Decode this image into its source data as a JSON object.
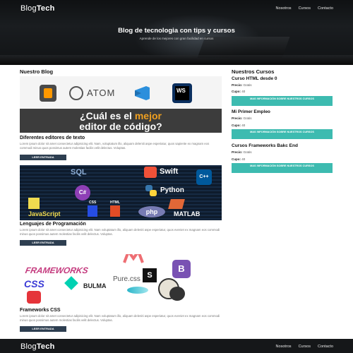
{
  "brand": {
    "name_light": "Blog",
    "name_bold": "Tech"
  },
  "nav": {
    "items": [
      "Nosotros",
      "Cursos",
      "Contacto"
    ]
  },
  "hero": {
    "title": "Blog de tecnologia con tips y cursos",
    "subtitle": "Aprende de los mejores con gran facilidad en cursos"
  },
  "blog": {
    "heading": "Nuestro Blog",
    "posts": [
      {
        "title": "Diferentes editores de texto",
        "excerpt": "Lorem ipsum dolor sit amet consectetur adipisicing elit. Nam, voluptatum illo, aliquam deleniti aspe esperiatur, quos sapiente ex magnam eos commodi minus quos possimus autem molestias facilis velit delectus. Voluptas.",
        "button": "LEER ENTRADA",
        "image_text": {
          "q1": "¿Cuál es el ",
          "hl": "mejor",
          "q2": "editor de código?",
          "atom": "ATOM",
          "ws": "WS"
        }
      },
      {
        "title": "Lenguajes de Programación",
        "excerpt": "Lorem ipsum dolor sit amet consectetur adipisicing elit. Nam voluptatum illo, aliquam deleniti aspe esperiatur, quos eveniet ex magnam eos commodi minus quos possimus autem molestias facilis velit delectus. Voluptas.",
        "button": "LEER ENTRADA",
        "image_text": {
          "sql": "SQL",
          "swift": "Swift",
          "python": "Python",
          "js": "JavaScript",
          "css": "CSS",
          "html": "HTML",
          "php": "php",
          "matlab": "MATLAB",
          "cs": "C#",
          "cpp": "C++"
        }
      },
      {
        "title": "Frameworks CSS",
        "excerpt": "Lorem ipsum dolor sit amet consectetur adipisicing elit. Nam voluptatum illo, aliquam deleniti aspe esperiatur, quos eveniet ex magnam eos commodi minus quos possimus autem molestias facilis velit delectus. Voluptas.",
        "button": "LEER ENTRADA",
        "image_text": {
          "frameworks": "FRAMEWORKS",
          "css": "CSS",
          "bulma": "BULMA",
          "pure": "Pure.css",
          "s": "S",
          "b": "B"
        }
      }
    ]
  },
  "courses": {
    "heading": "Nuestros Cursos",
    "price_label": "Precio:",
    "quota_label": "Cupo:",
    "items": [
      {
        "name": "Curso HTML desde 0",
        "price": "Gratis",
        "quota": "40",
        "button": "MAS INFORMACIÓN SOBRE NUESTROS CURSOS"
      },
      {
        "name": "Mi Primer Empleo",
        "price": "Gratis",
        "quota": "40",
        "button": "MAS INFORMACIÓN SOBRE NUESTROS CURSOS"
      },
      {
        "name": "Cursos Frameworks Bakc End",
        "price": "Gratis",
        "quota": "40",
        "button": "MAS INFORMACIÓN SOBRE NUESTROS CURSOS"
      }
    ]
  },
  "colors": {
    "teal": "#3dbbb0",
    "navy": "#2d3e50",
    "dark": "#151719",
    "accent": "#f0a020"
  }
}
